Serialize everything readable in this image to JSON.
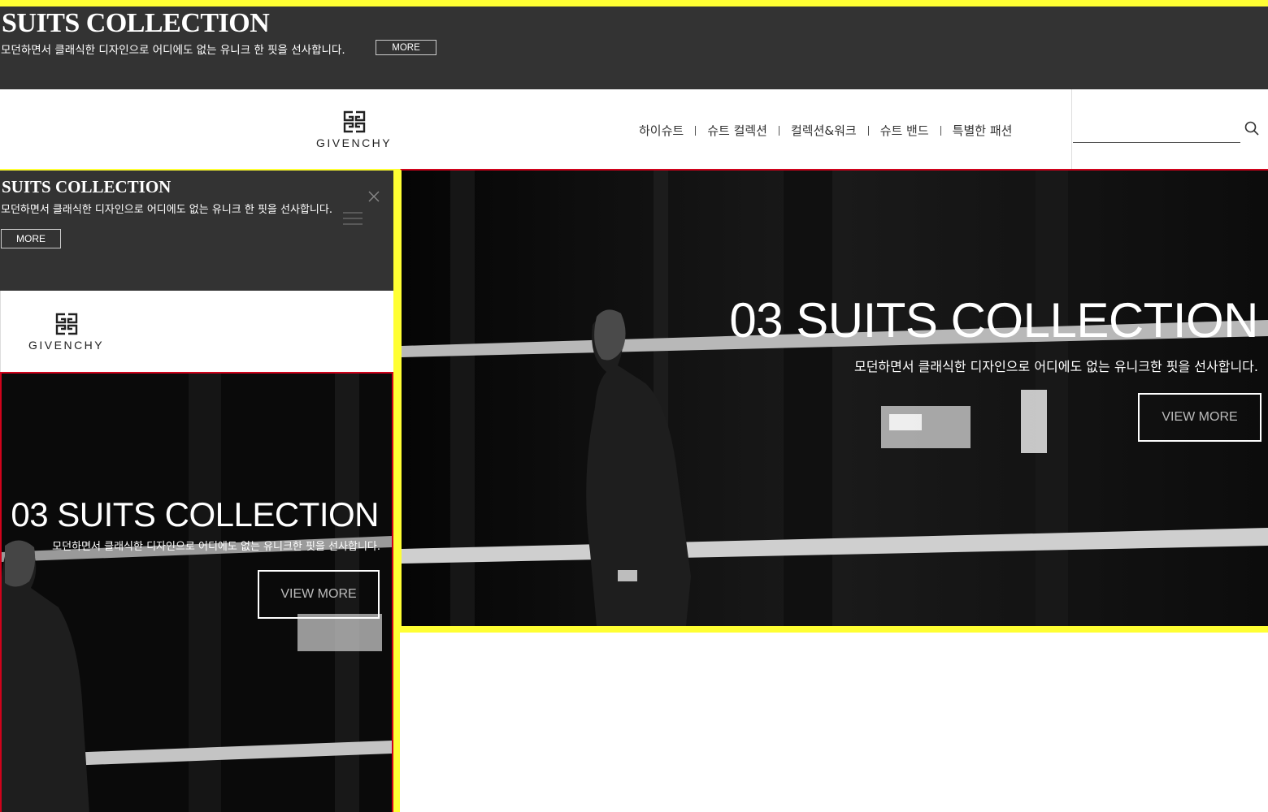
{
  "banner": {
    "title": "SUITS COLLECTION",
    "description": "모던하면서 클래식한 디자인으로 어디에도 없는 유니크 한 핏을 선사합니다.",
    "more_label": "MORE"
  },
  "brand": {
    "name": "GIVENCHY"
  },
  "nav": {
    "items": [
      "하이슈트",
      "슈트 컬렉션",
      "컬렉션&워크",
      "슈트 밴드",
      "특별한 패션"
    ]
  },
  "search": {
    "placeholder": ""
  },
  "hero": {
    "title": "03 SUITS COLLECTION",
    "description": "모던하면서 클래식한 디자인으로 어디에도 없는 유니크한 핏을 선사합니다.",
    "button_label": "VIEW MORE"
  },
  "mobile": {
    "banner": {
      "title": "SUITS COLLECTION",
      "description": "모던하면서 클래식한 디자인으로 어디에도 없는 유니크 한 핏을 선사합니다.",
      "more_label": "MORE"
    }
  },
  "icons": {
    "search": "search-icon",
    "close": "close-icon",
    "menu": "hamburger-menu-icon",
    "logo": "givenchy-4g-logo-icon"
  },
  "colors": {
    "banner_bg": "#333333",
    "highlight_yellow": "#ffff33",
    "highlight_red": "#d0021b",
    "hero_bg": "#0b0b0b"
  }
}
